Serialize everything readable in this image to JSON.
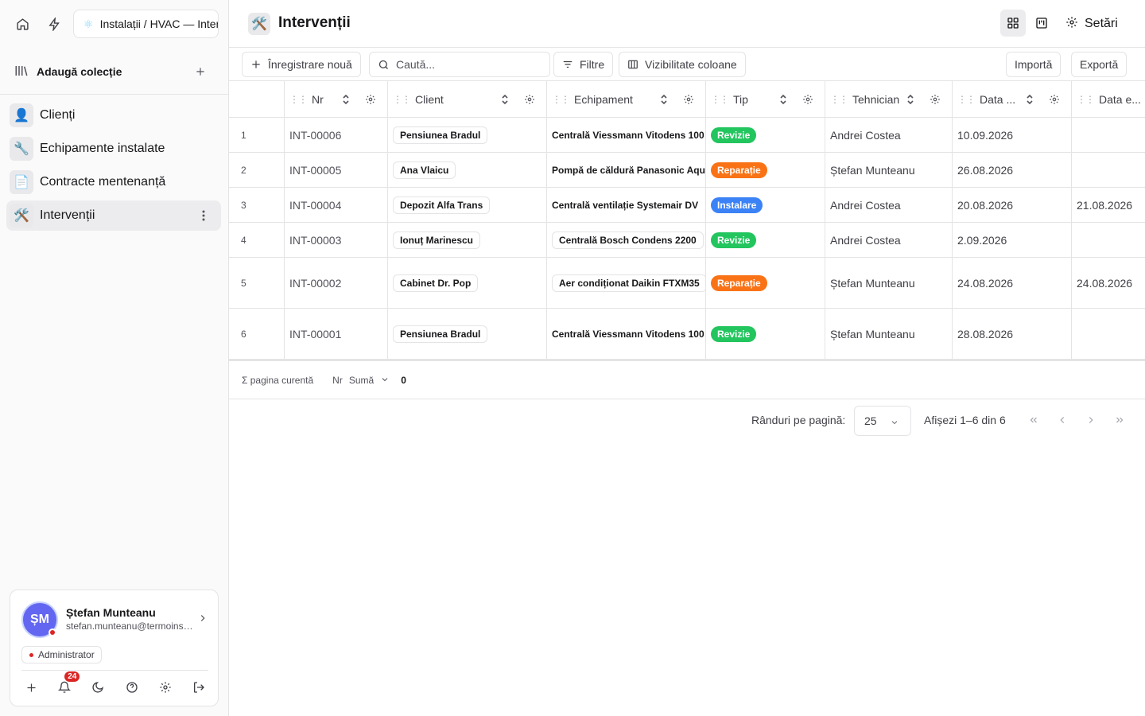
{
  "sidebar": {
    "breadcrumb": "Instalații / HVAC — Intervenții",
    "add_collection": "Adaugă colecție",
    "items": [
      {
        "emoji": "👤",
        "label": "Clienți"
      },
      {
        "emoji": "🔧",
        "label": "Echipamente instalate"
      },
      {
        "emoji": "📄",
        "label": "Contracte mentenanță"
      },
      {
        "emoji": "🛠️",
        "label": "Intervenții"
      }
    ],
    "user": {
      "initials": "ȘM",
      "name": "Ștefan Munteanu",
      "email": "stefan.munteanu@termoinstal.ro",
      "role": "Administrator",
      "notifications": "24"
    }
  },
  "header": {
    "emoji": "🛠️",
    "title": "Intervenții",
    "settings_label": "Setări"
  },
  "toolbar": {
    "new_record": "Înregistrare nouă",
    "search_placeholder": "Caută...",
    "filters": "Filtre",
    "columns_visibility": "Vizibilitate coloane",
    "import": "Importă",
    "export": "Exportă"
  },
  "table": {
    "columns": [
      "Nr",
      "Client",
      "Echipament",
      "Tip",
      "Tehnician",
      "Data ...",
      "Data e..."
    ],
    "rows": [
      {
        "idx": "1",
        "nr": "INT-00006",
        "client": "Pensiunea Bradul",
        "equipment": "Centrală Viessmann Vitodens 100",
        "type": "Revizie",
        "type_color": "#22c55e",
        "tech": "Andrei Costea",
        "date": "10.09.2026",
        "date_end": ""
      },
      {
        "idx": "2",
        "nr": "INT-00005",
        "client": "Ana Vlaicu",
        "equipment": "Pompă de căldură Panasonic Aquarea",
        "type": "Reparație",
        "type_color": "#f97316",
        "tech": "Ștefan Munteanu",
        "date": "26.08.2026",
        "date_end": ""
      },
      {
        "idx": "3",
        "nr": "INT-00004",
        "client": "Depozit Alfa Trans",
        "equipment": "Centrală ventilație Systemair DV",
        "type": "Instalare",
        "type_color": "#3b82f6",
        "tech": "Andrei Costea",
        "date": "20.08.2026",
        "date_end": "21.08.2026"
      },
      {
        "idx": "4",
        "nr": "INT-00003",
        "client": "Ionuț Marinescu",
        "equipment": "Centrală Bosch Condens 2200",
        "type": "Revizie",
        "type_color": "#22c55e",
        "tech": "Andrei Costea",
        "date": "2.09.2026",
        "date_end": ""
      },
      {
        "idx": "5",
        "nr": "INT-00002",
        "client": "Cabinet Dr. Pop",
        "equipment": "Aer condiționat Daikin FTXM35",
        "type": "Reparație",
        "type_color": "#f97316",
        "tech": "Ștefan Munteanu",
        "date": "24.08.2026",
        "date_end": "24.08.2026"
      },
      {
        "idx": "6",
        "nr": "INT-00001",
        "client": "Pensiunea Bradul",
        "equipment": "Centrală Viessmann Vitodens 100",
        "type": "Revizie",
        "type_color": "#22c55e",
        "tech": "Ștefan Munteanu",
        "date": "28.08.2026",
        "date_end": ""
      }
    ]
  },
  "summary": {
    "label": "Σ pagina curentă",
    "field": "Nr",
    "agg": "Sumă",
    "value": "0"
  },
  "pagination": {
    "rows_per_page_label": "Rânduri pe pagină:",
    "rows_per_page": "25",
    "range": "Afișezi 1–6 din 6"
  }
}
